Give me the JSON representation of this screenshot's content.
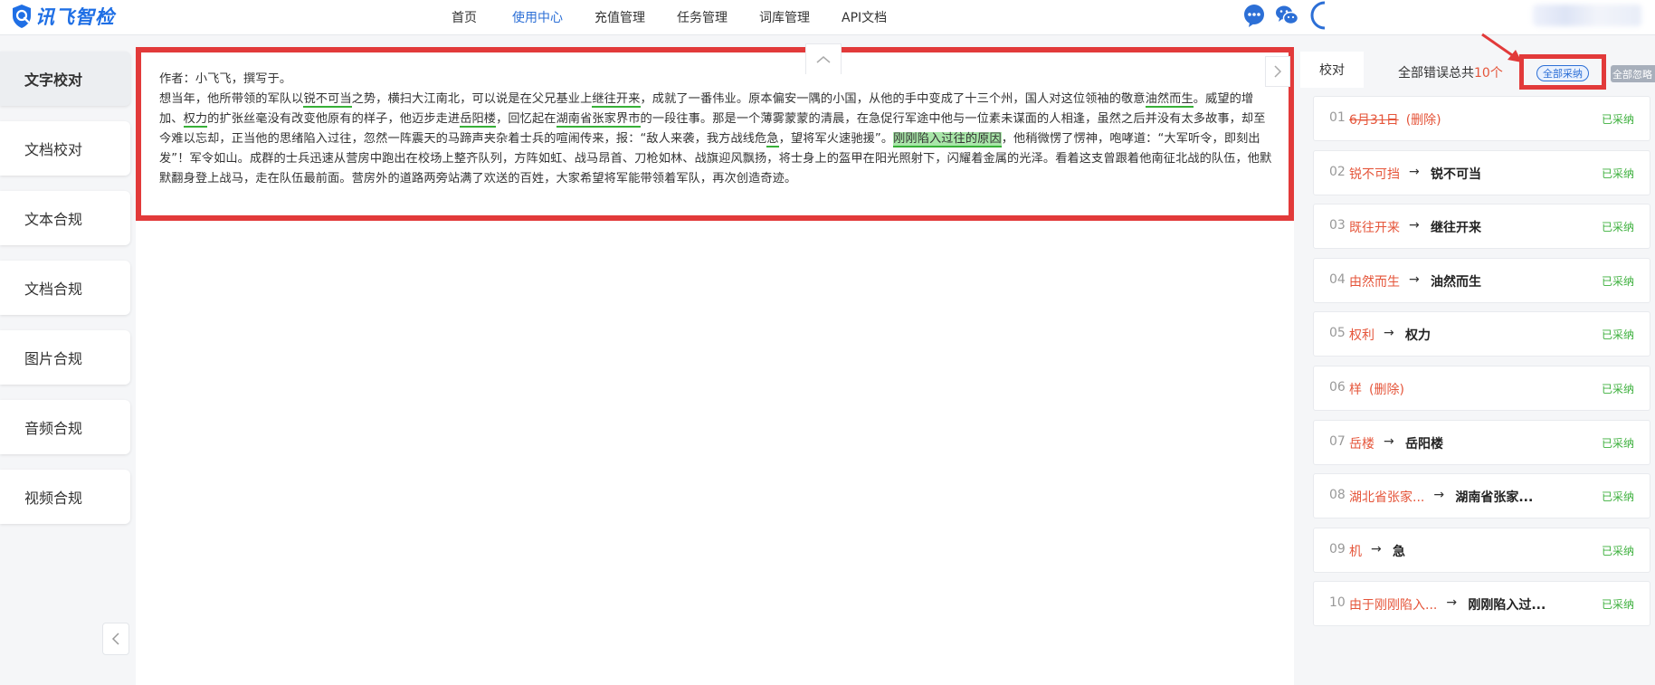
{
  "brand": {
    "name": "讯飞智检",
    "color": "#1f6fe5"
  },
  "nav": {
    "items": [
      "首页",
      "使用中心",
      "充值管理",
      "任务管理",
      "词库管理",
      "API文档"
    ],
    "active": "使用中心"
  },
  "header_icons": [
    "chat-bubble-icon",
    "wechat-icon",
    "user-avatar"
  ],
  "sidebar": {
    "items": [
      "文字校对",
      "文档校对",
      "文本合规",
      "文档合规",
      "图片合规",
      "音频合规",
      "视频合规"
    ],
    "active": "文字校对"
  },
  "editor": {
    "segments": [
      {
        "t": "作者：小飞飞，撰写于。"
      },
      {
        "t": "\n"
      },
      {
        "t": "想当年，他所带领的军队以"
      },
      {
        "t": "锐不可当",
        "m": "u"
      },
      {
        "t": "之势，横扫大江南北，可以说是在父兄基业上"
      },
      {
        "t": "继往开来",
        "m": "u"
      },
      {
        "t": "，成就了一番伟业。原本偏安一隅的小国，从他的手中变成了十三个州，国人对这位领袖的敬意"
      },
      {
        "t": "油然而生",
        "m": "u"
      },
      {
        "t": "。威望的增加、"
      },
      {
        "t": "权力",
        "m": "u"
      },
      {
        "t": "的扩张丝毫没有改变他原有的样子，他迈步走进"
      },
      {
        "t": "岳阳楼",
        "m": "u"
      },
      {
        "t": "，回忆起在"
      },
      {
        "t": "湖南省张家界市",
        "m": "u"
      },
      {
        "t": "的一段往事。那是一个薄雾蒙蒙的清晨，在急促行军途中他与一位素未谋面的人相逢，虽然之后并没有太多故事，却至今难以忘却，正当他的思绪陷入过往，忽然一阵震天的马蹄声夹杂着士兵的喧闹传来，报：“敌人来袭，我方战线危"
      },
      {
        "t": "急",
        "m": "u"
      },
      {
        "t": "，望将军火速驰援”。"
      },
      {
        "t": "刚刚陷入过往的原因",
        "m": "hl"
      },
      {
        "t": "，他稍微愣了愣神，咆哮道：“大军听令，即刻出发”！军令如山。成群的士兵迅速从营房中跑出在校场上整齐队列，方阵如虹、战马昂首、刀枪如林、战旗迎风飘扬，将士身上的盔甲在阳光照射下，闪耀着金属的光泽。看着这支曾跟着他南征北战的队伍，他默默翻身登上战马，走在队伍最前面。营房外的道路两旁站满了欢送的百姓，大家希望将军能带领着军队，再次创造奇迹。"
      }
    ]
  },
  "results": {
    "tab_label": "校对",
    "total_prefix": "全部错误总共",
    "total_count": "10个",
    "accept_all": "全部采纳",
    "ignore_all": "全部忽略",
    "items": [
      {
        "num": "01",
        "orig": "6月31日",
        "fix": "",
        "del": "(删除)",
        "strike": true,
        "status": "已采纳"
      },
      {
        "num": "02",
        "orig": "锐不可挡",
        "fix": "锐不可当",
        "del": "",
        "strike": false,
        "status": "已采纳"
      },
      {
        "num": "03",
        "orig": "既往开来",
        "fix": "继往开来",
        "del": "",
        "strike": false,
        "status": "已采纳"
      },
      {
        "num": "04",
        "orig": "由然而生",
        "fix": "油然而生",
        "del": "",
        "strike": false,
        "status": "已采纳"
      },
      {
        "num": "05",
        "orig": "权利",
        "fix": "权力",
        "del": "",
        "strike": false,
        "status": "已采纳"
      },
      {
        "num": "06",
        "orig": "样",
        "fix": "",
        "del": "(删除)",
        "strike": false,
        "status": "已采纳"
      },
      {
        "num": "07",
        "orig": "岳楼",
        "fix": "岳阳楼",
        "del": "",
        "strike": false,
        "status": "已采纳"
      },
      {
        "num": "08",
        "orig": "湖北省张家...",
        "fix": "湖南省张家...",
        "del": "",
        "strike": false,
        "status": "已采纳"
      },
      {
        "num": "09",
        "orig": "机",
        "fix": "急",
        "del": "",
        "strike": false,
        "status": "已采纳"
      },
      {
        "num": "10",
        "orig": "由于刚刚陷入...",
        "fix": "刚刚陷入过...",
        "del": "",
        "strike": false,
        "status": "已采纳"
      }
    ]
  },
  "colors": {
    "error": "#e5553a",
    "accepted": "#3db03d",
    "accent": "#2c6fd6",
    "highlight_box": "#e23a3a",
    "underline": "#38b038"
  }
}
